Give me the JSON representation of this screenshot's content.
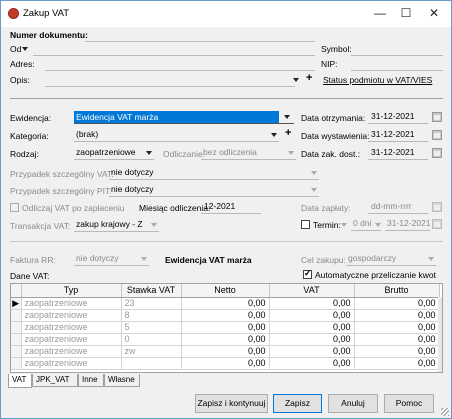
{
  "window": {
    "title": "Zakup VAT",
    "minimize": "—",
    "maximize": "☐",
    "close": "✕"
  },
  "header": {
    "numer_label": "Numer dokumentu:",
    "od_label": "Od",
    "adres_label": "Adres:",
    "opis_label": "Opis:",
    "symbol_label": "Symbol:",
    "nip_label": "NIP:",
    "status_link": "Status podmiotu w VAT/VIES"
  },
  "form": {
    "ewidencja_label": "Ewidencja:",
    "ewidencja_value": "Ewidencja VAT marża",
    "kategoria_label": "Kategoria:",
    "kategoria_value": "(brak)",
    "rodzaj_label": "Rodzaj:",
    "rodzaj_value": "zaopatrzeniowe",
    "odliczanie_label": "Odliczanie:",
    "odliczanie_value": "bez odliczenia",
    "psvat_label": "Przypadek szczególny VAT:",
    "psvat_value": "nie dotyczy",
    "pspit_label": "Przypadek szczególny PIT:",
    "pspit_value": "nie dotyczy",
    "odliczaj_label": "Odliczaj VAT po zapłaceniu",
    "miesiac_label": "Miesiąc odliczenia:",
    "miesiac_value": "12-2021",
    "transakcja_label": "Transakcja VAT:",
    "transakcja_value": "zakup krajowy - Z",
    "data_otrz_label": "Data otrzymania:",
    "data_otrz_value": "31-12-2021",
    "data_wyst_label": "Data wystawienia:",
    "data_wyst_value": "31-12-2021",
    "data_zak_label": "Data zak. dost.:",
    "data_zak_value": "31-12-2021",
    "data_zapl_label": "Data zapłaty:",
    "data_zapl_placeholder": "dd-mm-rrrr",
    "termin_label": "Termin:",
    "termin_dni": "0 dni",
    "termin_date": "31-12-2021",
    "faktura_rr_label": "Faktura RR:",
    "faktura_rr_value": "nie dotyczy",
    "ewidencja_tag": "Ewidencja VAT marża",
    "cel_label": "Cel zakupu:",
    "cel_value": "gospodarczy",
    "dane_vat_label": "Dane VAT:",
    "auto_label": "Automatyczne przeliczanie kwot"
  },
  "table": {
    "headers": [
      "Typ",
      "Stawka VAT",
      "Netto",
      "VAT",
      "Brutto"
    ],
    "rows": [
      [
        "zaopatrzeniowe",
        "23",
        "0,00",
        "0,00",
        "0,00"
      ],
      [
        "zaopatrzeniowe",
        "8",
        "0,00",
        "0,00",
        "0,00"
      ],
      [
        "zaopatrzeniowe",
        "5",
        "0,00",
        "0,00",
        "0,00"
      ],
      [
        "zaopatrzeniowe",
        "0",
        "0,00",
        "0,00",
        "0,00"
      ],
      [
        "zaopatrzeniowe",
        "zw",
        "0,00",
        "0,00",
        "0,00"
      ],
      [
        "zaopatrzeniowe",
        "",
        "0,00",
        "0,00",
        "0,00"
      ]
    ]
  },
  "tabs": [
    "VAT",
    "JPK_VAT",
    "Inne",
    "Własne"
  ],
  "buttons": {
    "save_continue": "Zapisz i kontynuuj",
    "save": "Zapisz",
    "cancel": "Anuluj",
    "help": "Pomoc"
  }
}
